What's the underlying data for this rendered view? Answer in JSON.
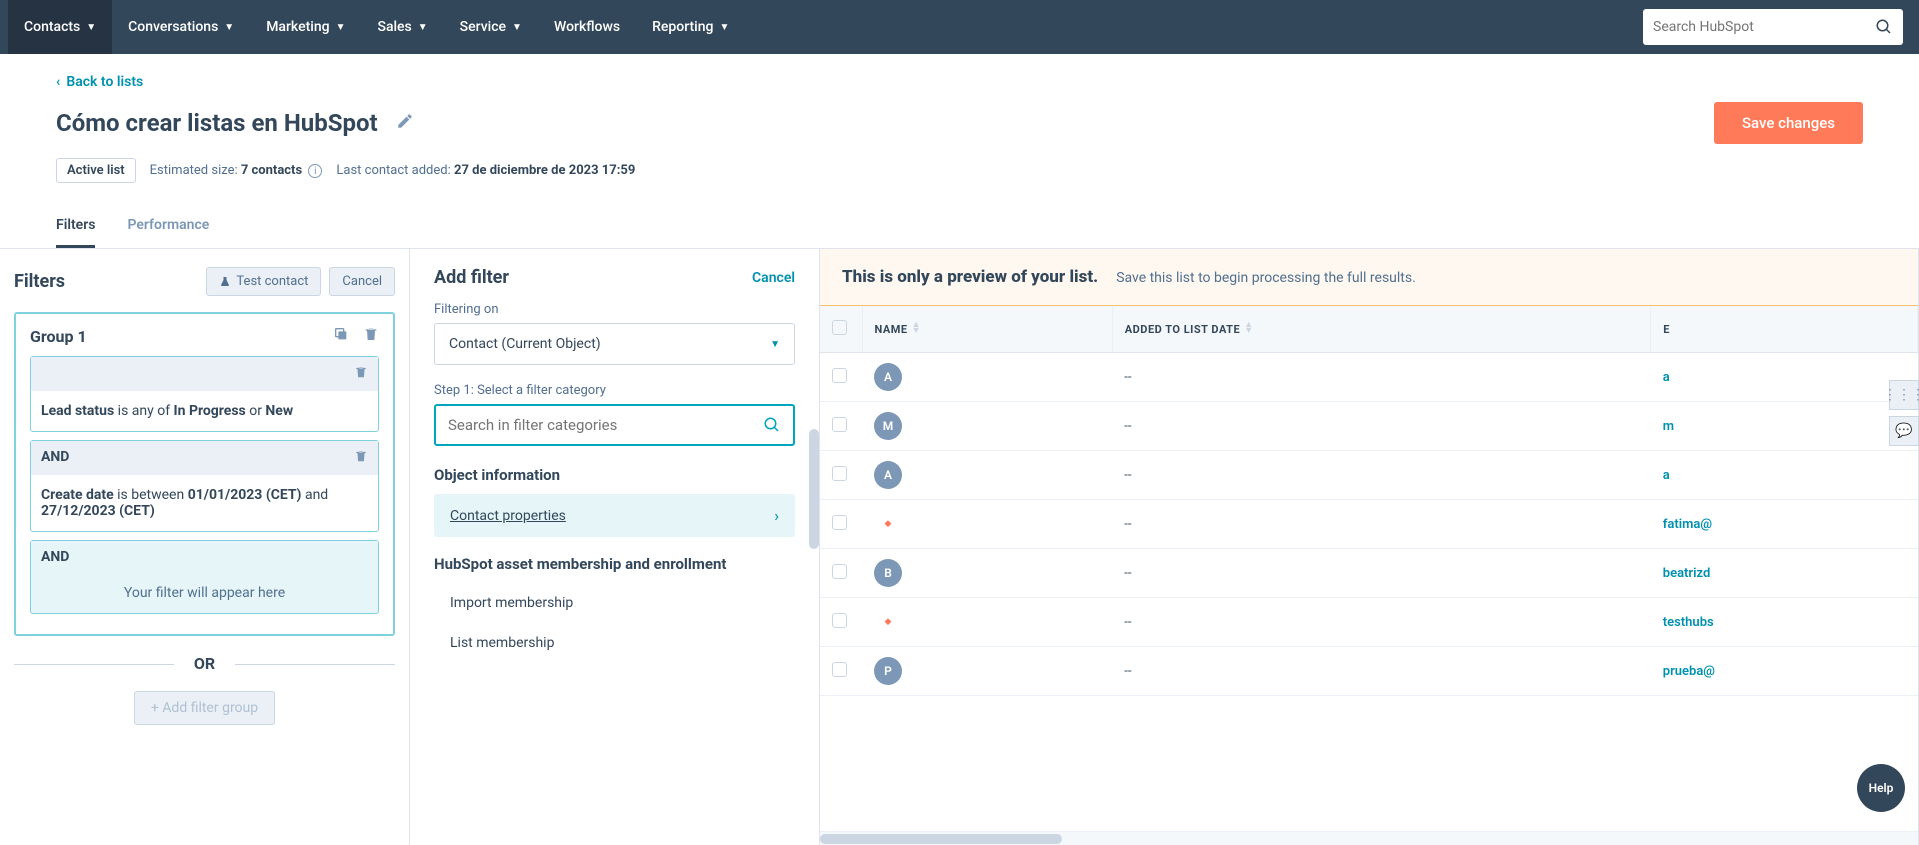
{
  "nav": {
    "items": [
      "Contacts",
      "Conversations",
      "Marketing",
      "Sales",
      "Service",
      "Workflows",
      "Reporting"
    ],
    "search_placeholder": "Search HubSpot"
  },
  "header": {
    "back": "Back to lists",
    "title": "Cómo crear listas en HubSpot",
    "save": "Save changes",
    "badge": "Active list",
    "est_label": "Estimated size: ",
    "est_value": "7 contacts",
    "last_label": "Last contact added: ",
    "last_value": "27 de diciembre de 2023 17:59"
  },
  "tabs": [
    "Filters",
    "Performance"
  ],
  "filters": {
    "title": "Filters",
    "test_btn": "Test contact",
    "cancel_btn": "Cancel",
    "group": "Group 1",
    "and": "AND",
    "placeholder": "Your filter will appear here",
    "or": "OR",
    "add_group": "Add filter group",
    "f1": {
      "prop": "Lead status",
      "verb": " is any of ",
      "v1": "In Progress",
      "or": " or ",
      "v2": "New"
    },
    "f2": {
      "prop": "Create date",
      "verb": " is between ",
      "v1": "01/01/2023 (CET)",
      "and": " and ",
      "v2": "27/12/2023 (CET)"
    }
  },
  "addfilter": {
    "title": "Add filter",
    "cancel": "Cancel",
    "filtering_on": "Filtering on",
    "object": "Contact (Current Object)",
    "step": "Step 1: Select a filter category",
    "search_placeholder": "Search in filter categories",
    "sec1": "Object information",
    "cat1": "Contact properties",
    "sec2": "HubSpot asset membership and enrollment",
    "cat2": "Import membership",
    "cat3": "List membership"
  },
  "preview": {
    "banner_title": "This is only a preview of your list.",
    "banner_sub": "Save this list to begin processing the full results.",
    "cols": [
      "NAME",
      "ADDED TO LIST DATE",
      "E"
    ],
    "rows": [
      {
        "avatar": "A",
        "type": "letter",
        "date": "--",
        "email": "a"
      },
      {
        "avatar": "M",
        "type": "letter",
        "date": "--",
        "email": "m"
      },
      {
        "avatar": "A",
        "type": "letter",
        "date": "--",
        "email": "a"
      },
      {
        "avatar": "",
        "type": "logo",
        "date": "--",
        "email": "fatima@"
      },
      {
        "avatar": "B",
        "type": "letter",
        "date": "--",
        "email": "beatrizd"
      },
      {
        "avatar": "",
        "type": "logo",
        "date": "--",
        "email": "testhubs"
      },
      {
        "avatar": "P",
        "type": "letter",
        "date": "--",
        "email": "prueba@"
      }
    ]
  },
  "help": "Help"
}
